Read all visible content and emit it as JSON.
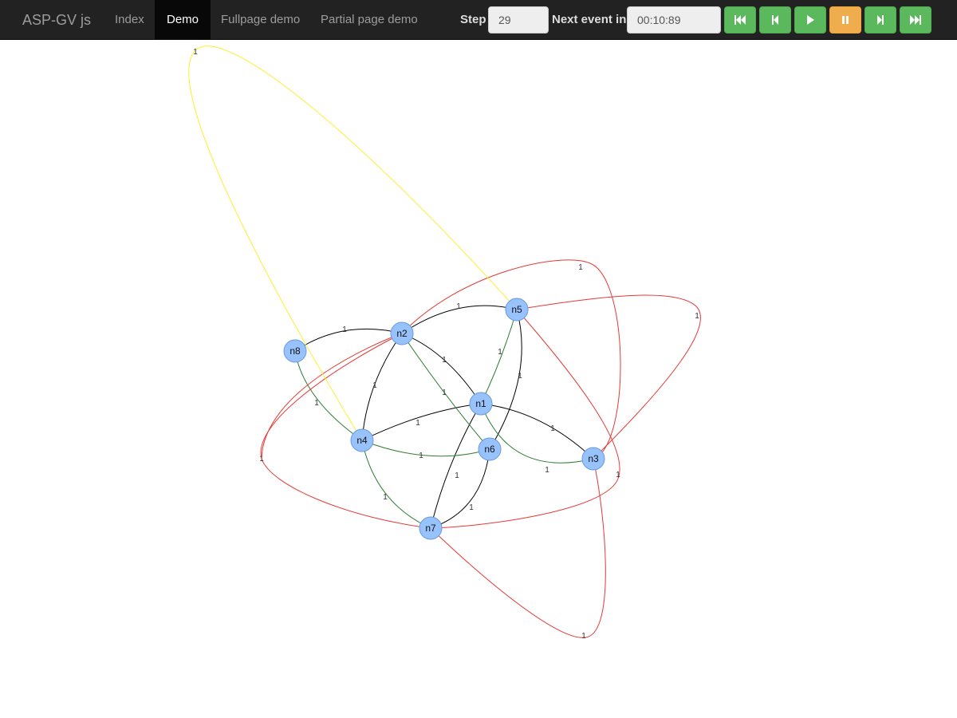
{
  "navbar": {
    "brand": "ASP-GV js",
    "links": [
      "Index",
      "Demo",
      "Fullpage demo",
      "Partial page demo"
    ],
    "active_link": "Demo",
    "step_label": "Step",
    "step_value": "29",
    "next_event_label": "Next event in",
    "next_event_value": "00:10:89",
    "controls": [
      {
        "name": "first-step",
        "icon": "fast-backward-icon",
        "state": "normal"
      },
      {
        "name": "previous-step",
        "icon": "step-backward-icon",
        "state": "normal"
      },
      {
        "name": "play",
        "icon": "play-icon",
        "state": "normal"
      },
      {
        "name": "pause",
        "icon": "pause-icon",
        "state": "active"
      },
      {
        "name": "next-step",
        "icon": "step-forward-icon",
        "state": "normal"
      },
      {
        "name": "last-step",
        "icon": "fast-forward-icon",
        "state": "normal"
      }
    ]
  },
  "colors": {
    "navbar_bg": "#222222",
    "button_green": "#5cb85c",
    "button_orange": "#f0ad4e",
    "node_fill": "#97c2fc",
    "edge_black": "#000000",
    "edge_green": "#2e7d32",
    "edge_red": "#e53935",
    "edge_yellow": "#ffee33"
  },
  "graph": {
    "nodes": [
      "n1",
      "n2",
      "n3",
      "n4",
      "n5",
      "n6",
      "n7",
      "n8"
    ],
    "edges": [
      {
        "from": "n8",
        "to": "n2",
        "label": "1",
        "color": "black"
      },
      {
        "from": "n2",
        "to": "n5",
        "label": "1",
        "color": "black"
      },
      {
        "from": "n2",
        "to": "n1",
        "label": "1",
        "color": "black"
      },
      {
        "from": "n2",
        "to": "n4",
        "label": "1",
        "color": "black"
      },
      {
        "from": "n4",
        "to": "n1",
        "label": "1",
        "color": "black"
      },
      {
        "from": "n1",
        "to": "n3",
        "label": "1",
        "color": "black"
      },
      {
        "from": "n1",
        "to": "n7",
        "label": "1",
        "color": "black"
      },
      {
        "from": "n5",
        "to": "n6",
        "label": "1",
        "color": "black"
      },
      {
        "from": "n6",
        "to": "n7",
        "label": "1",
        "color": "black"
      },
      {
        "from": "n8",
        "to": "n4",
        "label": "1",
        "color": "green"
      },
      {
        "from": "n2",
        "to": "n6",
        "label": "1",
        "color": "green"
      },
      {
        "from": "n5",
        "to": "n1",
        "label": "1",
        "color": "green"
      },
      {
        "from": "n4",
        "to": "n6",
        "label": "1",
        "color": "green"
      },
      {
        "from": "n4",
        "to": "n7",
        "label": "1",
        "color": "green"
      },
      {
        "from": "n1",
        "to": "n3",
        "label": "1",
        "color": "green"
      },
      {
        "from": "n2",
        "to": "n3",
        "label": "1",
        "color": "red"
      },
      {
        "from": "n5",
        "to": "n3",
        "label": "1",
        "color": "red"
      },
      {
        "from": "n5",
        "to": "n7",
        "label": "1",
        "color": "red"
      },
      {
        "from": "n3",
        "to": "n7",
        "label": "1",
        "color": "red"
      },
      {
        "from": "n7",
        "to": "n3",
        "label": "1",
        "color": "red"
      },
      {
        "from": "n2",
        "to": "n7",
        "label": "1",
        "color": "red"
      },
      {
        "from": "n4",
        "to": "n5",
        "label": "1",
        "color": "yellow"
      }
    ]
  }
}
